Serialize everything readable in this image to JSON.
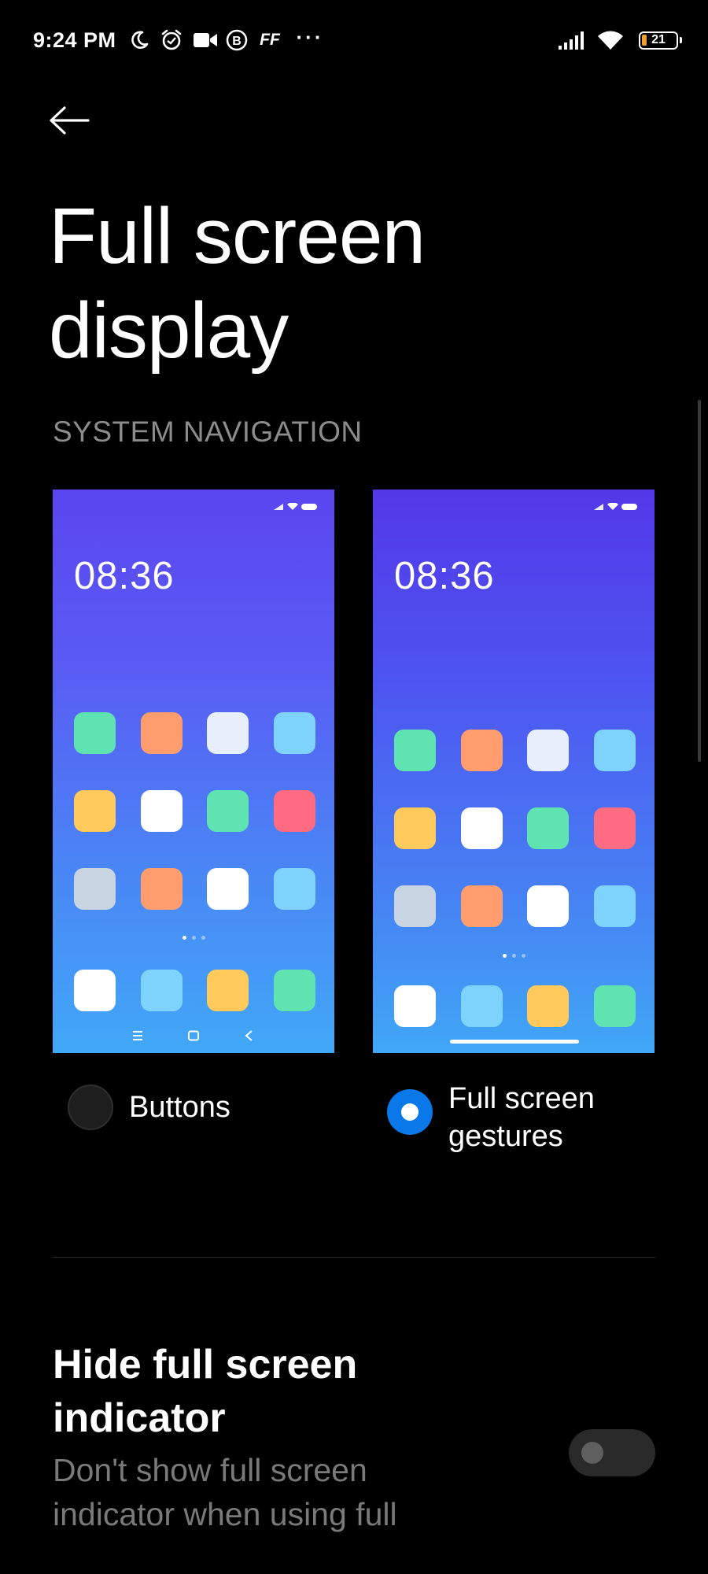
{
  "status_bar": {
    "time": "9:24 PM",
    "icons": [
      "moon-icon",
      "alarm-icon",
      "video-icon",
      "b-circle-icon",
      "ff-icon",
      "more-dots-icon",
      "signal-icon",
      "wifi-icon",
      "battery-icon"
    ],
    "ff_text": "FF",
    "more": "···",
    "battery_level": "21"
  },
  "header": {
    "back_icon": "arrow-left-icon",
    "title": "Full screen display"
  },
  "section": {
    "label": "SYSTEM NAVIGATION"
  },
  "previews": [
    {
      "clock": "08:36",
      "navigation": "buttons",
      "nav_icons": [
        "menu-icon",
        "home-square-icon",
        "back-chevron-icon"
      ],
      "icon_colors": [
        [
          "#5fe3b1",
          "#ff9d6f",
          "#e7effc",
          "#7dd3fb"
        ],
        [
          "#ffc95c",
          "#ffffff",
          "#5fe3b1",
          "#ff6b81"
        ],
        [
          "#c8d4e2",
          "#ff9d6f",
          "#ffffff",
          "#7dd3fb"
        ]
      ],
      "dock_colors": [
        "#ffffff",
        "#7dd3fb",
        "#ffc95c",
        "#5fe3b1"
      ]
    },
    {
      "clock": "08:36",
      "navigation": "gestures",
      "icon_colors": [
        [
          "#5fe3b1",
          "#ff9d6f",
          "#e7effc",
          "#7dd3fb"
        ],
        [
          "#ffc95c",
          "#ffffff",
          "#5fe3b1",
          "#ff6b81"
        ],
        [
          "#c8d4e2",
          "#ff9d6f",
          "#ffffff",
          "#7dd3fb"
        ]
      ],
      "dock_colors": [
        "#ffffff",
        "#7dd3fb",
        "#ffc95c",
        "#5fe3b1"
      ]
    }
  ],
  "options": [
    {
      "label": "Buttons",
      "selected": false
    },
    {
      "label_line1": "Full screen",
      "label_line2": "gestures",
      "selected": true
    }
  ],
  "setting": {
    "title": "Hide full screen indicator",
    "description": "Don't show full screen indicator when using full",
    "toggle_on": false
  },
  "colors": {
    "accent": "#0a78e8",
    "background": "#000000",
    "secondary_text": "#8c8c8c"
  }
}
